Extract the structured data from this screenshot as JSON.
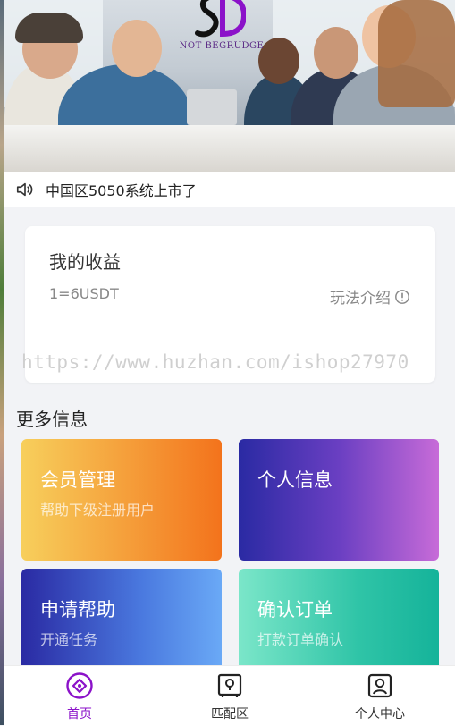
{
  "banner": {
    "logo_text": "NOT BEGRUDGE",
    "logo_letters": "SD"
  },
  "notice": {
    "icon": "speaker-icon",
    "text": "中国区5050系统上市了"
  },
  "income": {
    "title": "我的收益",
    "rate": "1=6USDT",
    "rules_label": "玩法介绍",
    "rules_icon": "info-icon"
  },
  "watermark": "https://www.huzhan.com/ishop27970",
  "more": {
    "title": "更多信息",
    "tiles": [
      {
        "title": "会员管理",
        "subtitle": "帮助下级注册用户"
      },
      {
        "title": "个人信息",
        "subtitle": ""
      },
      {
        "title": "申请帮助",
        "subtitle": "开通任务"
      },
      {
        "title": "确认订单",
        "subtitle": "打款订单确认"
      }
    ]
  },
  "tabbar": {
    "tabs": [
      {
        "label": "首页",
        "icon": "home-icon",
        "active": true
      },
      {
        "label": "匹配区",
        "icon": "match-icon",
        "active": false
      },
      {
        "label": "个人中心",
        "icon": "profile-icon",
        "active": false
      }
    ]
  },
  "colors": {
    "accent": "#8b12c9",
    "background": "#f2f3f6"
  }
}
